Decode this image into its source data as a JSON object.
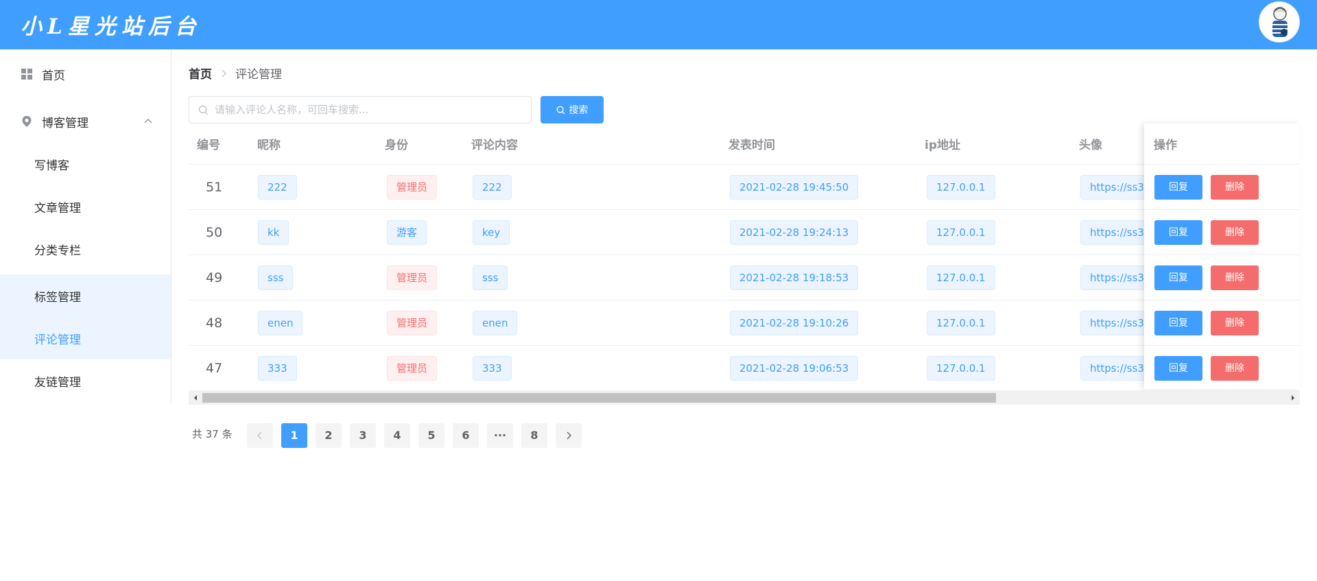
{
  "app": {
    "title": "小L星光站后台"
  },
  "colors": {
    "primary": "#409eff",
    "danger": "#f56c6c",
    "header_bg": "#409eff"
  },
  "sidebar": {
    "home": {
      "label": "首页",
      "icon": "grid-icon"
    },
    "group": {
      "label": "博客管理",
      "icon": "location-pin-icon",
      "expanded": true
    },
    "items": [
      {
        "label": "写博客"
      },
      {
        "label": "文章管理"
      },
      {
        "label": "分类专栏"
      },
      {
        "label": "标签管理",
        "hover": true
      },
      {
        "label": "评论管理",
        "active": true
      },
      {
        "label": "友链管理"
      }
    ]
  },
  "breadcrumb": {
    "home": "首页",
    "current": "评论管理"
  },
  "search": {
    "placeholder": "请输入评论人名称，可回车搜索...",
    "value": "",
    "button_label": "搜索"
  },
  "table": {
    "columns": [
      "编号",
      "昵称",
      "身份",
      "评论内容",
      "发表时间",
      "ip地址",
      "头像",
      "操作"
    ],
    "rows": [
      {
        "id": "51",
        "nickname": "222",
        "role": "管理员",
        "role_type": "danger",
        "content": "222",
        "time": "2021-02-28 19:45:50",
        "ip": "127.0.0.1",
        "avatar": "https://ss3."
      },
      {
        "id": "50",
        "nickname": "kk",
        "role": "游客",
        "role_type": "primary",
        "content": "key",
        "time": "2021-02-28 19:24:13",
        "ip": "127.0.0.1",
        "avatar": "https://ss3."
      },
      {
        "id": "49",
        "nickname": "sss",
        "role": "管理员",
        "role_type": "danger",
        "content": "sss",
        "time": "2021-02-28 19:18:53",
        "ip": "127.0.0.1",
        "avatar": "https://ss3."
      },
      {
        "id": "48",
        "nickname": "enen",
        "role": "管理员",
        "role_type": "danger",
        "content": "enen",
        "time": "2021-02-28 19:10:26",
        "ip": "127.0.0.1",
        "avatar": "https://ss3."
      },
      {
        "id": "47",
        "nickname": "333",
        "role": "管理员",
        "role_type": "danger",
        "content": "333",
        "time": "2021-02-28 19:06:53",
        "ip": "127.0.0.1",
        "avatar": "https://ss3."
      }
    ],
    "actions": {
      "reply": "回复",
      "delete": "删除"
    }
  },
  "pagination": {
    "total_text": "共 37 条",
    "pages": [
      "1",
      "2",
      "3",
      "4",
      "5",
      "6",
      "···",
      "8"
    ],
    "current": "1"
  }
}
